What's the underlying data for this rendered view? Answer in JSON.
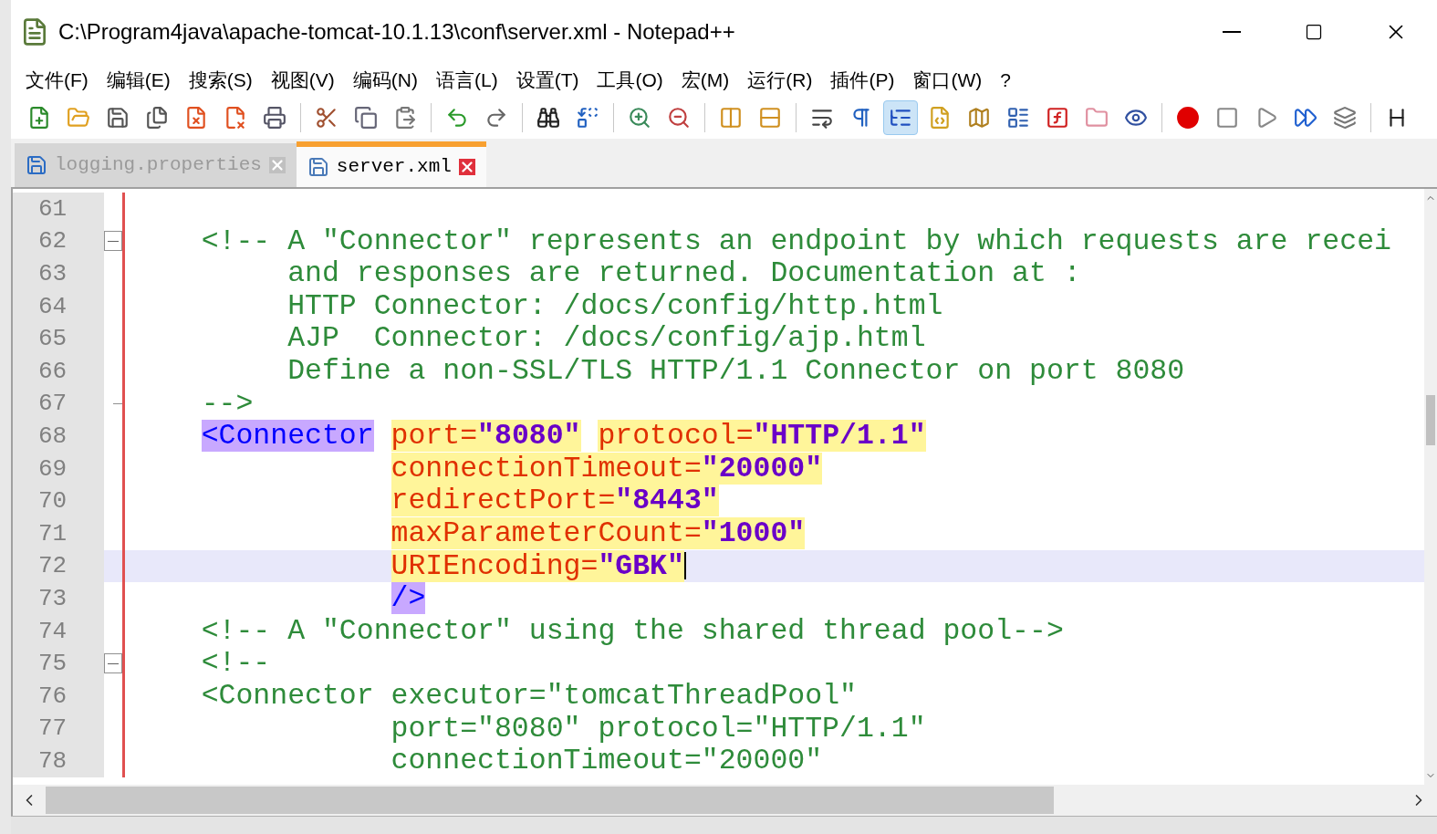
{
  "window": {
    "title": "C:\\Program4java\\apache-tomcat-10.1.13\\conf\\server.xml - Notepad++"
  },
  "menu": [
    "文件(F)",
    "编辑(E)",
    "搜索(S)",
    "视图(V)",
    "编码(N)",
    "语言(L)",
    "设置(T)",
    "工具(O)",
    "宏(M)",
    "运行(R)",
    "插件(P)",
    "窗口(W)",
    "?"
  ],
  "toolbar": [
    {
      "kind": "new",
      "pressed": false
    },
    {
      "kind": "open",
      "pressed": false
    },
    {
      "kind": "save",
      "pressed": false
    },
    {
      "kind": "save-all",
      "pressed": false
    },
    {
      "kind": "close",
      "pressed": false
    },
    {
      "kind": "close-all",
      "pressed": false
    },
    {
      "kind": "print",
      "pressed": false
    },
    {
      "kind": "sep"
    },
    {
      "kind": "cut",
      "pressed": false
    },
    {
      "kind": "copy",
      "pressed": false
    },
    {
      "kind": "paste",
      "pressed": false
    },
    {
      "kind": "sep"
    },
    {
      "kind": "undo",
      "pressed": false
    },
    {
      "kind": "redo",
      "pressed": false
    },
    {
      "kind": "sep"
    },
    {
      "kind": "find",
      "pressed": false
    },
    {
      "kind": "replace",
      "pressed": false
    },
    {
      "kind": "sep"
    },
    {
      "kind": "zoom-in",
      "pressed": false
    },
    {
      "kind": "zoom-out",
      "pressed": false
    },
    {
      "kind": "sep"
    },
    {
      "kind": "sync-v",
      "pressed": false
    },
    {
      "kind": "sync-h",
      "pressed": false
    },
    {
      "kind": "sep"
    },
    {
      "kind": "wrap",
      "pressed": false
    },
    {
      "kind": "all-chars",
      "pressed": false
    },
    {
      "kind": "indent-guide",
      "pressed": true
    },
    {
      "kind": "udl",
      "pressed": false
    },
    {
      "kind": "doc-map",
      "pressed": false
    },
    {
      "kind": "doc-list",
      "pressed": false
    },
    {
      "kind": "function-list",
      "pressed": false
    },
    {
      "kind": "folder",
      "pressed": false
    },
    {
      "kind": "monitor",
      "pressed": false
    },
    {
      "kind": "sep"
    },
    {
      "kind": "record",
      "pressed": false
    },
    {
      "kind": "stop",
      "pressed": false
    },
    {
      "kind": "play",
      "pressed": false
    },
    {
      "kind": "play-multi",
      "pressed": false
    },
    {
      "kind": "save-macro",
      "pressed": false
    },
    {
      "kind": "sep"
    },
    {
      "kind": "heading",
      "pressed": false
    }
  ],
  "tabs": [
    {
      "label": "logging.properties",
      "selected": false
    },
    {
      "label": "server.xml",
      "selected": true
    }
  ],
  "lines": [
    {
      "number": "61",
      "current": false
    },
    {
      "number": "62",
      "current": false,
      "fold": {
        "expanded": true
      },
      "segments": [
        {
          "text": "    <!-- A \"Connector\" represents an endpoint by which requests are recei",
          "kind": "comment"
        }
      ]
    },
    {
      "number": "63",
      "current": false,
      "segments": [
        {
          "text": "         and responses are returned. Documentation at :",
          "kind": "comment"
        }
      ]
    },
    {
      "number": "64",
      "current": false,
      "segments": [
        {
          "text": "         HTTP Connector: /docs/config/http.html",
          "kind": "comment"
        }
      ]
    },
    {
      "number": "65",
      "current": false,
      "segments": [
        {
          "text": "         AJP  Connector: /docs/config/ajp.html",
          "kind": "comment"
        }
      ]
    },
    {
      "number": "66",
      "current": false,
      "segments": [
        {
          "text": "         Define a non-SSL/TLS HTTP/1.1 Connector on port 8080",
          "kind": "comment"
        }
      ]
    },
    {
      "number": "67",
      "current": false,
      "fold_end": true,
      "segments": [
        {
          "text": "    -->",
          "kind": "comment"
        }
      ]
    },
    {
      "number": "68",
      "current": false,
      "segments": [
        {
          "text": "    <Connector",
          "kind": "tag",
          "match": true
        },
        {
          "text": " port=",
          "kind": "attr",
          "match": true
        },
        {
          "text": "\"8080\"",
          "kind": "value",
          "match": true
        },
        {
          "text": " protocol=",
          "kind": "attr",
          "match": true
        },
        {
          "text": "\"HTTP/1.1\"",
          "kind": "value",
          "match": true
        }
      ]
    },
    {
      "number": "69",
      "current": false,
      "segments": [
        {
          "text": "               connectionTimeout=",
          "kind": "attr",
          "match": true
        },
        {
          "text": "\"20000\"",
          "kind": "value",
          "match": true
        }
      ]
    },
    {
      "number": "70",
      "current": false,
      "segments": [
        {
          "text": "               redirectPort=",
          "kind": "attr",
          "match": true
        },
        {
          "text": "\"8443\"",
          "kind": "value",
          "match": true
        }
      ]
    },
    {
      "number": "71",
      "current": false,
      "segments": [
        {
          "text": "               maxParameterCount=",
          "kind": "attr",
          "match": true
        },
        {
          "text": "\"1000\"",
          "kind": "value",
          "match": true
        }
      ]
    },
    {
      "number": "72",
      "current": true,
      "segments": [
        {
          "text": "               URIEncoding=",
          "kind": "attr",
          "match": true
        },
        {
          "text": "\"GBK\"",
          "kind": "value",
          "match": true
        }
      ]
    },
    {
      "number": "73",
      "current": false,
      "segments": [
        {
          "text": "               />",
          "kind": "tag",
          "match": true
        }
      ]
    },
    {
      "number": "74",
      "current": false,
      "segments": [
        {
          "text": "    <!-- A \"Connector\" using the shared thread pool-->",
          "kind": "comment"
        }
      ]
    },
    {
      "number": "75",
      "current": false,
      "fold": {
        "expanded": true
      },
      "segments": [
        {
          "text": "    <!--",
          "kind": "comment"
        }
      ]
    },
    {
      "number": "76",
      "current": false,
      "segments": [
        {
          "text": "    <Connector executor=\"tomcatThreadPool\"",
          "kind": "comment"
        }
      ]
    },
    {
      "number": "77",
      "current": false,
      "segments": [
        {
          "text": "               port=\"8080\" protocol=\"HTTP/1.1\"",
          "kind": "comment"
        }
      ]
    },
    {
      "number": "78",
      "current": false,
      "segments": [
        {
          "text": "               connectionTimeout=\"20000\"",
          "kind": "comment"
        }
      ]
    }
  ]
}
